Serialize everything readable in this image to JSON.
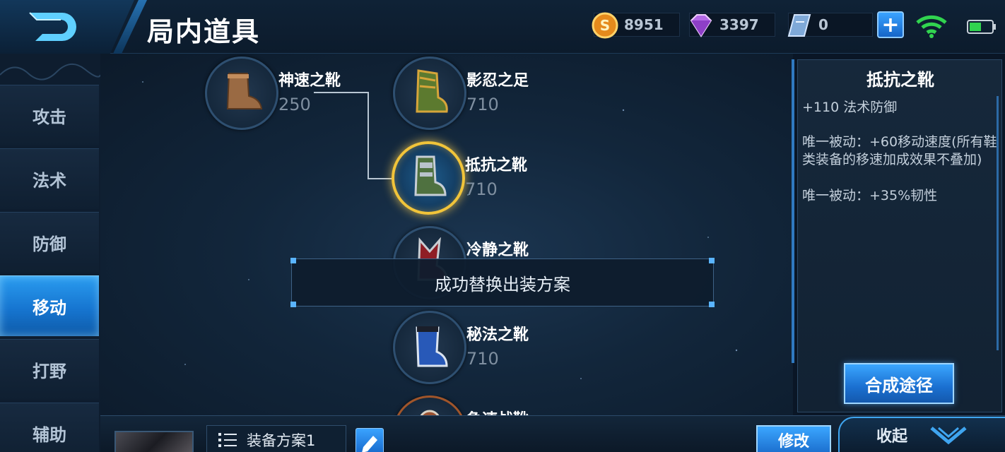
{
  "header": {
    "title": "局内道具",
    "gold": "8951",
    "diamonds": "3397",
    "vouchers": "0"
  },
  "sidebar": {
    "tabs": [
      {
        "label": "攻击"
      },
      {
        "label": "法术"
      },
      {
        "label": "防御"
      },
      {
        "label": "移动",
        "active": true
      },
      {
        "label": "打野"
      },
      {
        "label": "辅助"
      }
    ]
  },
  "items": [
    {
      "name": "神速之靴",
      "price": "250",
      "icon": "brown-boot-icon"
    },
    {
      "name": "影忍之足",
      "price": "710",
      "icon": "green-ninja-boot-icon"
    },
    {
      "name": "抵抗之靴",
      "price": "710",
      "icon": "green-armored-boot-icon",
      "selected": true
    },
    {
      "name": "冷静之靴",
      "price": "",
      "icon": "red-boot-icon"
    },
    {
      "name": "秘法之靴",
      "price": "710",
      "icon": "blue-arcane-boot-icon"
    },
    {
      "name": "急速战靴",
      "price": "",
      "icon": "orange-war-boot-icon"
    }
  ],
  "toast": {
    "message": "成功替换出装方案"
  },
  "detail": {
    "title": "抵抗之靴",
    "stat": "+110 法术防御",
    "passive1": "唯一被动：+60移动速度(所有鞋类装备的移速加成效果不叠加)",
    "passive2": "唯一被动：+35%韧性",
    "craft_label": "合成途径"
  },
  "bottom": {
    "loadout_label": "装备方案1",
    "modify_label": "修改",
    "collapse_label": "收起"
  },
  "colors": {
    "accent": "#2a9cf0",
    "selected_ring": "#f1c43a",
    "background": "#0a1626"
  }
}
